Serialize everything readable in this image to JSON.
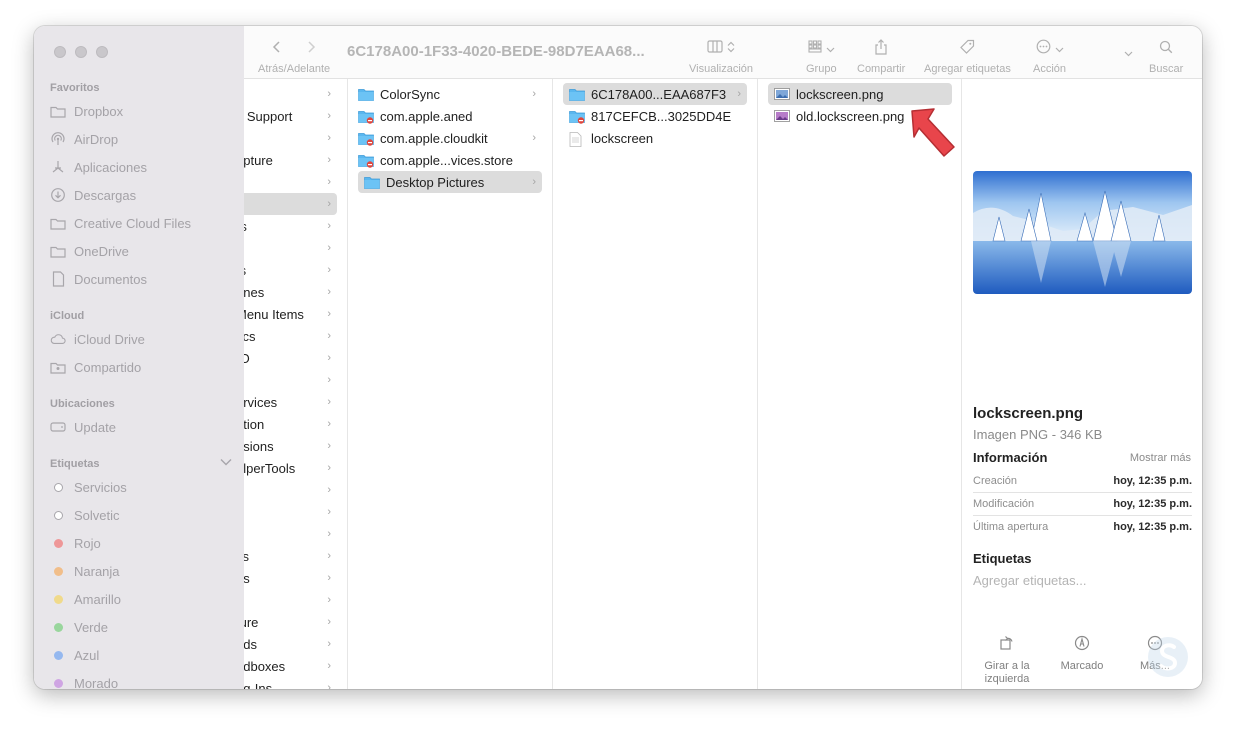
{
  "sidebar": {
    "sections": [
      {
        "title": "Favoritos",
        "items": [
          {
            "label": "Dropbox",
            "icon": "folder-icon"
          },
          {
            "label": "AirDrop",
            "icon": "airdrop-icon"
          },
          {
            "label": "Aplicaciones",
            "icon": "applications-icon"
          },
          {
            "label": "Descargas",
            "icon": "downloads-icon"
          },
          {
            "label": "Creative Cloud Files",
            "icon": "folder-icon"
          },
          {
            "label": "OneDrive",
            "icon": "folder-icon"
          },
          {
            "label": "Documentos",
            "icon": "document-icon"
          }
        ]
      },
      {
        "title": "iCloud",
        "items": [
          {
            "label": "iCloud Drive",
            "icon": "cloud-icon"
          },
          {
            "label": "Compartido",
            "icon": "shared-folder-icon"
          }
        ]
      },
      {
        "title": "Ubicaciones",
        "items": [
          {
            "label": "Update",
            "icon": "disk-icon"
          }
        ]
      },
      {
        "title": "Etiquetas",
        "items": [
          {
            "label": "Servicios",
            "color": "#ffffff"
          },
          {
            "label": "Solvetic",
            "color": "#ffffff"
          },
          {
            "label": "Rojo",
            "color": "#f07c7c"
          },
          {
            "label": "Naranja",
            "color": "#f4b06a"
          },
          {
            "label": "Amarillo",
            "color": "#f3d56b"
          },
          {
            "label": "Verde",
            "color": "#7fd083"
          },
          {
            "label": "Azul",
            "color": "#79a8f0"
          },
          {
            "label": "Morado",
            "color": "#c78fe0"
          }
        ]
      }
    ]
  },
  "toolbar": {
    "nav_label": "Atrás/Adelante",
    "title": "6C178A00-1F33-4020-BEDE-98D7EAA68...",
    "view_label": "Visualización",
    "group_label": "Grupo",
    "share_label": "Compartir",
    "tags_label": "Agregar etiquetas",
    "action_label": "Acción",
    "search_label": "Buscar"
  },
  "column1": {
    "rows": [
      "",
      "n Support",
      "",
      "apture",
      "",
      "",
      "rs",
      "",
      "ts",
      "ones",
      " Menu Items",
      "tics",
      "IO",
      "",
      "ervices",
      "ation",
      "nsions",
      "elperTools",
      "",
      "s",
      "",
      "ks",
      "es",
      "",
      "ture",
      "ods",
      "ndboxes",
      "ug-Ins"
    ],
    "selected_index": 5
  },
  "column2": {
    "rows": [
      {
        "label": "ColorSync",
        "icon": "folder",
        "chevron": true
      },
      {
        "label": "com.apple.aned",
        "icon": "folder-locked",
        "chevron": false
      },
      {
        "label": "com.apple.cloudkit",
        "icon": "folder-locked",
        "chevron": true
      },
      {
        "label": "com.apple...vices.store",
        "icon": "folder-locked",
        "chevron": false
      },
      {
        "label": "Desktop Pictures",
        "icon": "folder",
        "chevron": true
      }
    ],
    "selected_index": 4
  },
  "column3": {
    "rows": [
      {
        "label": "6C178A00...EAA687F3",
        "icon": "folder",
        "chevron": true
      },
      {
        "label": "817CEFCB...3025DD4E",
        "icon": "folder-locked",
        "chevron": false
      },
      {
        "label": "lockscreen",
        "icon": "file",
        "chevron": false
      }
    ],
    "selected_index": 0
  },
  "column4": {
    "rows": [
      {
        "label": "lockscreen.png",
        "icon": "image"
      },
      {
        "label": "old.lockscreen.png",
        "icon": "image"
      }
    ],
    "selected_index": 0
  },
  "preview": {
    "filename": "lockscreen.png",
    "kind": "Imagen PNG - 346 KB",
    "info_title": "Información",
    "show_more": "Mostrar más",
    "info": [
      {
        "key": "Creación",
        "value": "hoy, 12:35 p.m."
      },
      {
        "key": "Modificación",
        "value": "hoy, 12:35 p.m."
      },
      {
        "key": "Última apertura",
        "value": "hoy, 12:35 p.m."
      }
    ],
    "tags_title": "Etiquetas",
    "tags_placeholder": "Agregar etiquetas...",
    "actions": [
      {
        "label": "Girar a la izquierda",
        "icon": "rotate-left-icon"
      },
      {
        "label": "Marcado",
        "icon": "markup-icon"
      },
      {
        "label": "Más...",
        "icon": "more-icon"
      }
    ]
  },
  "colors": {
    "arrow": "#e8454b",
    "folder": "#4fb3ee"
  }
}
